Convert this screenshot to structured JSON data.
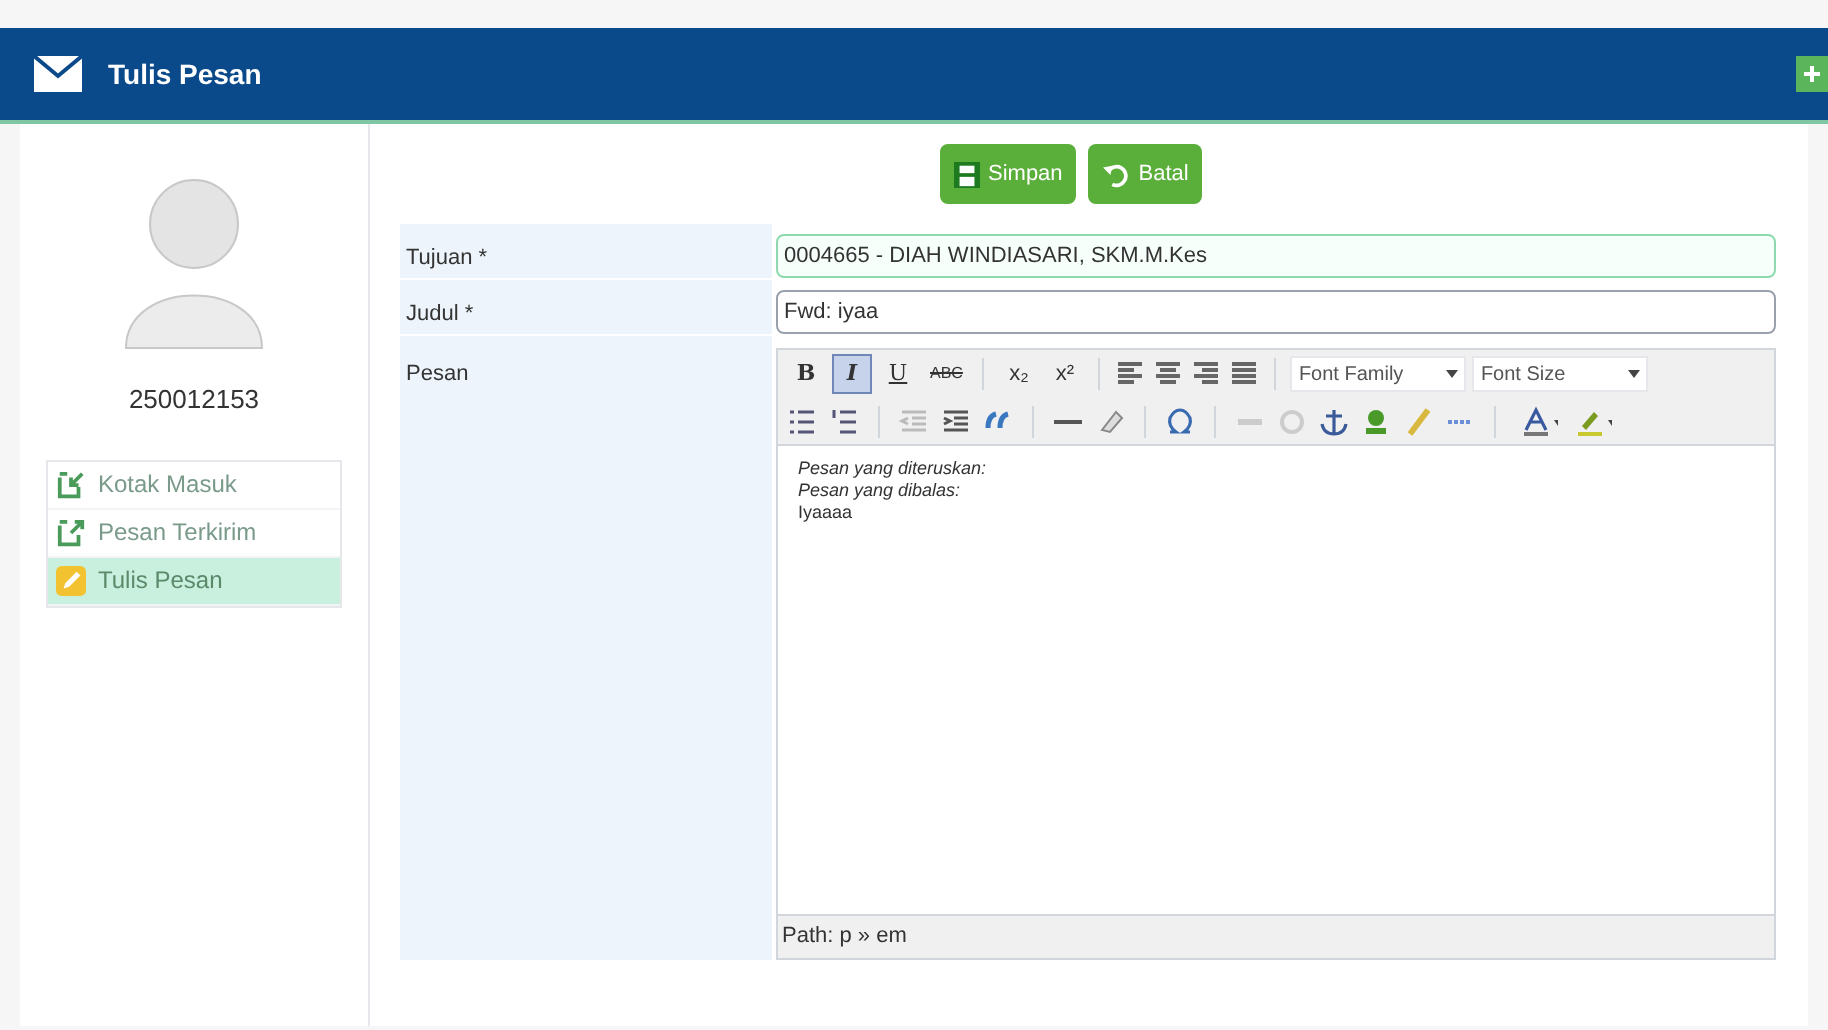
{
  "window": {
    "title": "Tulis Pesan"
  },
  "profile": {
    "user_id": "250012153"
  },
  "sidebar": {
    "items": [
      {
        "label": "Kotak Masuk",
        "kind": "inbox",
        "selected": false
      },
      {
        "label": "Pesan Terkirim",
        "kind": "sent",
        "selected": false
      },
      {
        "label": "Tulis Pesan",
        "kind": "compose",
        "selected": true
      }
    ]
  },
  "actions": [
    {
      "label": "Simpan",
      "kind": "save"
    },
    {
      "label": "Batal",
      "kind": "cancel"
    }
  ],
  "form": {
    "fields": [
      {
        "label": "Tujuan *",
        "value": "0004665 - DIAH WINDIASARI, SKM.M.Kes",
        "focused": true
      },
      {
        "label": "Judul *",
        "value": "Fwd: iyaa",
        "focused": false
      }
    ],
    "message_label": "Pesan"
  },
  "editor": {
    "format_buttons": [
      {
        "label": "B",
        "kind": "bold",
        "selected": false
      },
      {
        "label": "I",
        "kind": "italic",
        "selected": true
      },
      {
        "label": "U",
        "kind": "underline",
        "selected": false
      },
      {
        "label": "ABC",
        "kind": "strike",
        "selected": false
      },
      {
        "label": "x₂",
        "kind": "sub",
        "selected": false
      },
      {
        "label": "x²",
        "kind": "sup",
        "selected": false
      }
    ],
    "selects": [
      "Font Family",
      "Font Size"
    ],
    "content": [
      {
        "text": "Pesan yang diteruskan:",
        "italic": true
      },
      {
        "text": "Pesan yang dibalas:",
        "italic": true
      },
      {
        "text": "Iyaaaa",
        "italic": false
      }
    ],
    "path": "Path: p » em"
  }
}
